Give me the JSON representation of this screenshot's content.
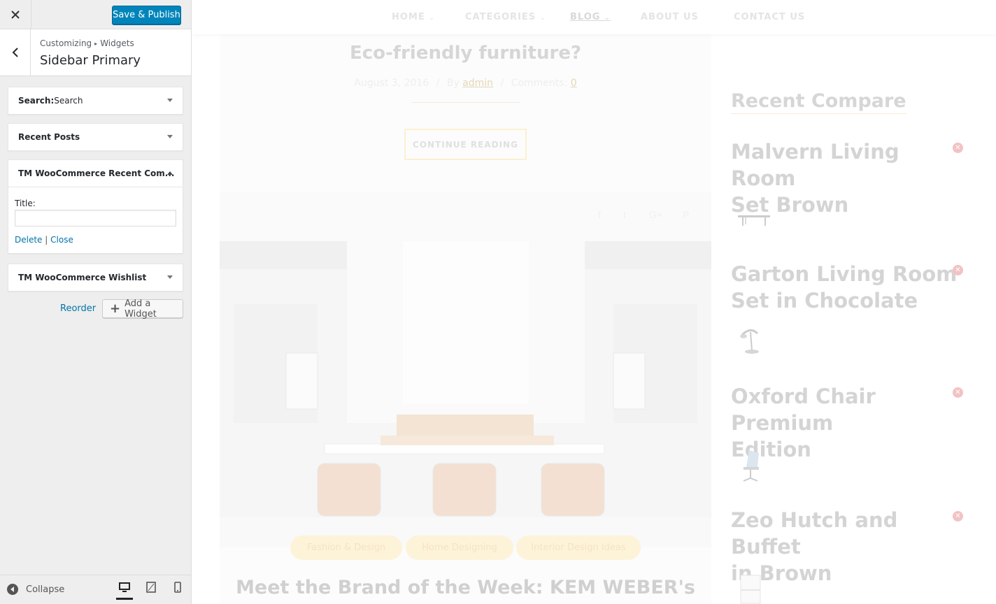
{
  "customizer": {
    "publish_label": "Save & Publish",
    "breadcrumb": [
      "Customizing",
      "Widgets"
    ],
    "section_title": "Sidebar Primary",
    "widgets": [
      {
        "title": "Search:",
        "subtitle": " Search"
      },
      {
        "title": "Recent Posts",
        "subtitle": ""
      },
      {
        "title": "TM WooCommerce Recent Com...",
        "subtitle": ""
      },
      {
        "title": "TM WooCommerce Wishlist",
        "subtitle": ""
      }
    ],
    "open_widget": {
      "field_label": "Title:",
      "field_value": "",
      "delete_label": "Delete",
      "separator": "|",
      "close_label": "Close"
    },
    "reorder_label": "Reorder",
    "add_widget_label": "Add a Widget",
    "collapse_label": "Collapse"
  },
  "preview": {
    "nav": [
      "HOME",
      "CATEGORIES",
      "BLOG",
      "ABOUT US",
      "CONTACT US"
    ],
    "post": {
      "title": "Eco-friendly furniture?",
      "date": "August 3, 2016",
      "by_label": "By",
      "author": "admin",
      "comments_label": "Comments:",
      "comments": "0",
      "continue_label": "CONTINUE READING",
      "tags": [
        "Fashion & Design",
        "Home Designing",
        "Interior Design Ideas"
      ]
    },
    "next_post_title": "Meet the Brand of the Week: KEM WEBER's",
    "sidebar": {
      "title": "Recent Compare",
      "items": [
        {
          "name_l1": "Malvern Living Room",
          "name_l2": "Set Brown"
        },
        {
          "name_l1": "Garton Living Room",
          "name_l2": "Set in Chocolate"
        },
        {
          "name_l1": "Oxford Chair Premium",
          "name_l2": "Edition"
        },
        {
          "name_l1": "Zeo Hutch and Buffet",
          "name_l2": "in Brown"
        }
      ]
    }
  }
}
